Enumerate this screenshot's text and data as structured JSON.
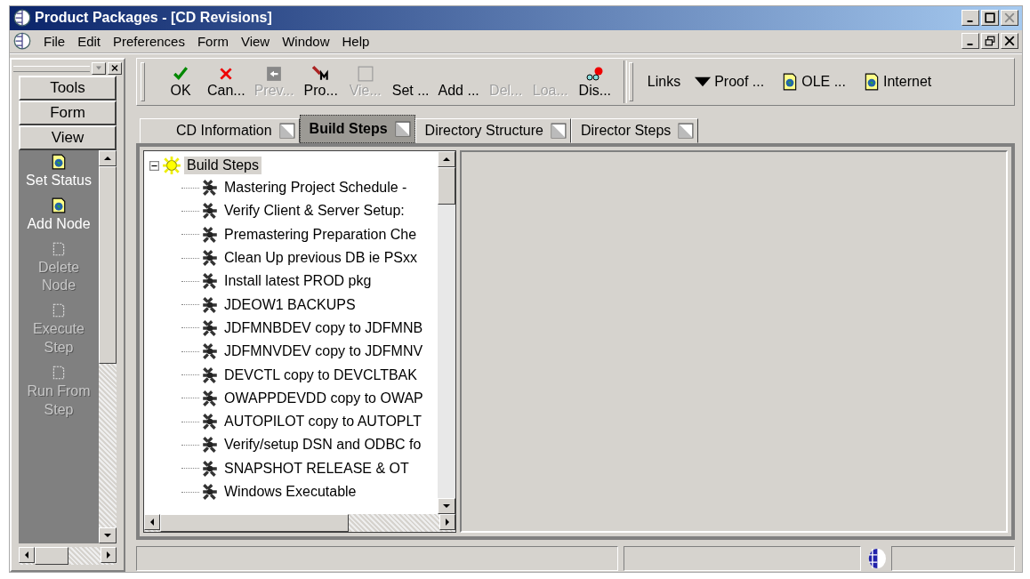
{
  "window": {
    "title": "Product Packages - [CD Revisions]"
  },
  "menu_bar": [
    "File",
    "Edit",
    "Preferences",
    "Form",
    "View",
    "Window",
    "Help"
  ],
  "toolbar": [
    {
      "label": "OK",
      "kind": "check",
      "disabled": false
    },
    {
      "label": "Can...",
      "kind": "cross",
      "disabled": false
    },
    {
      "label": "Prev...",
      "kind": "back",
      "disabled": true
    },
    {
      "label": "Pro...",
      "kind": "pencil",
      "disabled": false
    },
    {
      "label": "Vie...",
      "kind": "blank",
      "disabled": true
    },
    {
      "label": "Set ...",
      "kind": "none",
      "disabled": false
    },
    {
      "label": "Add ...",
      "kind": "none",
      "disabled": false
    },
    {
      "label": "Del...",
      "kind": "none",
      "disabled": true
    },
    {
      "label": "Loa...",
      "kind": "none",
      "disabled": true
    },
    {
      "label": "Dis...",
      "kind": "glasses",
      "disabled": false
    }
  ],
  "links": {
    "label": "Links",
    "items": [
      {
        "label": "Proof ...",
        "kind": "dropdown"
      },
      {
        "label": "OLE ...",
        "kind": "document"
      },
      {
        "label": "Internet",
        "kind": "document"
      }
    ]
  },
  "side_tabs": [
    "Tools",
    "Form",
    "View"
  ],
  "side_actions": [
    {
      "label": "Set Status",
      "disabled": false
    },
    {
      "label": "Add Node",
      "disabled": false
    },
    {
      "label": "Delete Node",
      "disabled": true
    },
    {
      "label": "Execute Step",
      "disabled": true
    },
    {
      "label": "Run From Step",
      "disabled": true
    }
  ],
  "tabs": [
    {
      "label": "CD Information",
      "selected": false
    },
    {
      "label": "Build Steps",
      "selected": true
    },
    {
      "label": "Directory Structure",
      "selected": false
    },
    {
      "label": "Director Steps",
      "selected": false
    }
  ],
  "tree": {
    "label": "Build Steps",
    "expanded": true,
    "selected": true,
    "children": [
      {
        "label": "Mastering Project Schedule -"
      },
      {
        "label": "Verify Client & Server Setup:"
      },
      {
        "label": "Premastering Preparation Che"
      },
      {
        "label": "Clean Up previous DB  ie PSxx"
      },
      {
        "label": "Install latest PROD pkg"
      },
      {
        "label": "JDEOW1 BACKUPS"
      },
      {
        "label": "JDFMNBDEV copy to JDFMNB"
      },
      {
        "label": "JDFMNVDEV copy to JDFMNV"
      },
      {
        "label": "DEVCTL copy to DEVCLTBAK"
      },
      {
        "label": "OWAPPDEVDD copy to OWAP"
      },
      {
        "label": "AUTOPILOT copy to AUTOPLT"
      },
      {
        "label": "Verify/setup DSN and ODBC fo"
      },
      {
        "label": "SNAPSHOT RELEASE & OT"
      },
      {
        "label": "Windows Executable"
      }
    ]
  }
}
